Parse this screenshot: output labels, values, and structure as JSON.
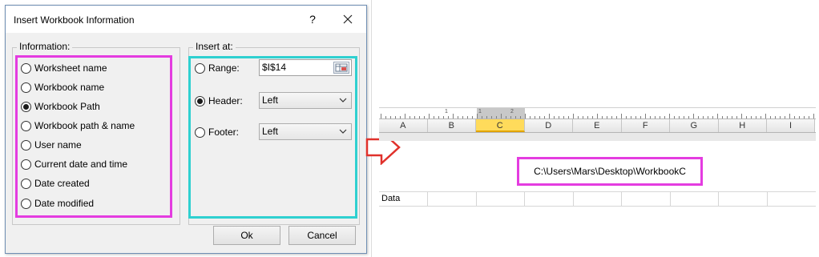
{
  "dialog": {
    "title": "Insert Workbook Information",
    "help_glyph": "?",
    "information_label": "Information:",
    "insert_at_label": "Insert at:",
    "info_options": [
      {
        "label": "Worksheet name",
        "selected": false
      },
      {
        "label": "Workbook name",
        "selected": false
      },
      {
        "label": "Workbook Path",
        "selected": true
      },
      {
        "label": "Workbook path & name",
        "selected": false
      },
      {
        "label": "User name",
        "selected": false
      },
      {
        "label": "Current date and time",
        "selected": false
      },
      {
        "label": "Date created",
        "selected": false
      },
      {
        "label": "Date modified",
        "selected": false
      }
    ],
    "insert_options": {
      "range_label": "Range:",
      "range_value": "$I$14",
      "header_label": "Header:",
      "header_value": "Left",
      "footer_label": "Footer:",
      "footer_value": "Left",
      "selected": "header"
    },
    "ok_label": "Ok",
    "cancel_label": "Cancel"
  },
  "sheet": {
    "ruler_numbers": [
      "1",
      "1",
      "2"
    ],
    "columns": [
      "A",
      "B",
      "C",
      "D",
      "E",
      "F",
      "G",
      "H",
      "I"
    ],
    "selected_column": "C",
    "header_text": "C:\\Users\\Mars\\Desktop\\WorkbookC",
    "first_cell": "Data"
  },
  "colors": {
    "highlight_info": "#e43ce0",
    "highlight_insert": "#2fd0d0",
    "arrow": "#e0312b",
    "selected_column": "#ffdb5b"
  }
}
